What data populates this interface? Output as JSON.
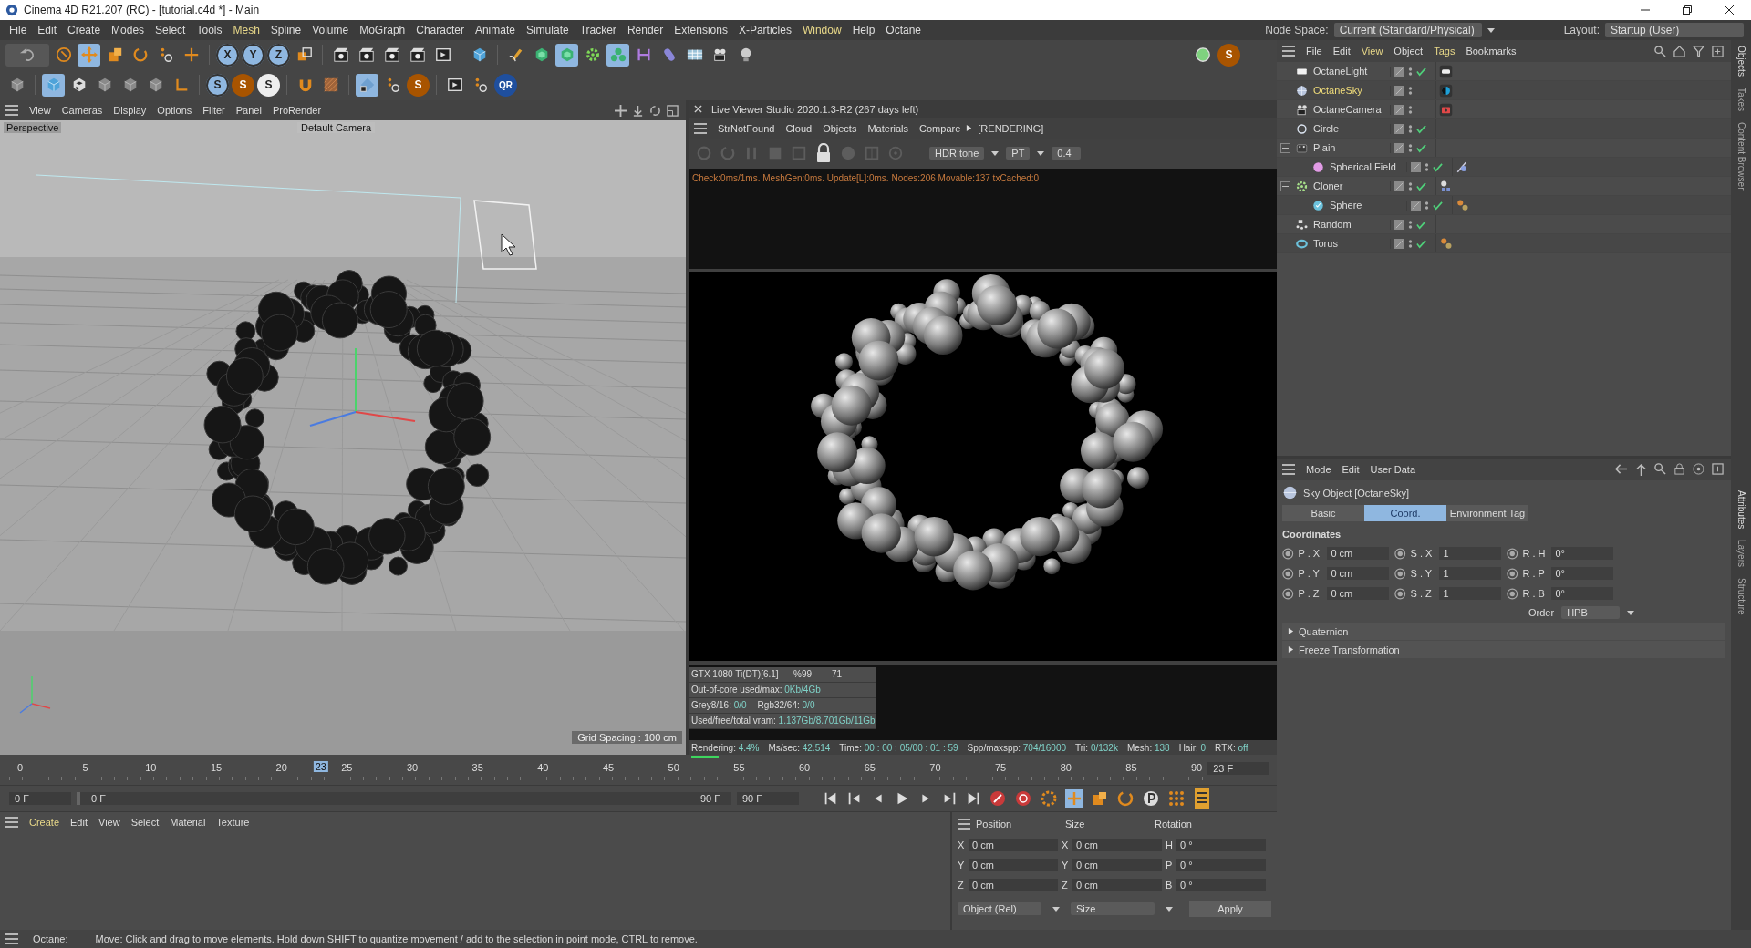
{
  "window": {
    "title": "Cinema 4D R21.207 (RC) - [tutorial.c4d *] - Main"
  },
  "menu": [
    {
      "label": "File",
      "highlight": false
    },
    {
      "label": "Edit",
      "highlight": false
    },
    {
      "label": "Create",
      "highlight": false
    },
    {
      "label": "Modes",
      "highlight": false
    },
    {
      "label": "Select",
      "highlight": false
    },
    {
      "label": "Tools",
      "highlight": false
    },
    {
      "label": "Mesh",
      "highlight": true
    },
    {
      "label": "Spline",
      "highlight": false
    },
    {
      "label": "Volume",
      "highlight": false
    },
    {
      "label": "MoGraph",
      "highlight": false
    },
    {
      "label": "Character",
      "highlight": false
    },
    {
      "label": "Animate",
      "highlight": false
    },
    {
      "label": "Simulate",
      "highlight": false
    },
    {
      "label": "Tracker",
      "highlight": false
    },
    {
      "label": "Render",
      "highlight": false
    },
    {
      "label": "Extensions",
      "highlight": false
    },
    {
      "label": "X-Particles",
      "highlight": false
    },
    {
      "label": "Window",
      "highlight": true
    },
    {
      "label": "Help",
      "highlight": false
    },
    {
      "label": "Octane",
      "highlight": false
    }
  ],
  "node_space": {
    "label": "Node Space:",
    "value": "Current (Standard/Physical)"
  },
  "layout": {
    "label": "Layout:",
    "value": "Startup (User)"
  },
  "toolbars": {
    "row_1": [
      {
        "kind": "undo",
        "selected": false
      },
      {
        "kind": "cursor",
        "selected": false
      },
      {
        "kind": "move",
        "selected": true
      },
      {
        "kind": "scale",
        "selected": false
      },
      {
        "kind": "rotate",
        "selected": false
      },
      {
        "kind": "dots",
        "selected": false
      },
      {
        "kind": "plus",
        "selected": false
      },
      {
        "kind": "letter",
        "label": "X",
        "selected": true
      },
      {
        "kind": "letter",
        "label": "Y",
        "selected": true
      },
      {
        "kind": "letter",
        "label": "Z",
        "selected": true
      },
      {
        "kind": "coord",
        "selected": false
      },
      {
        "kind": "clapper",
        "selected": false
      },
      {
        "kind": "clapper",
        "selected": false
      },
      {
        "kind": "clapper",
        "selected": false
      },
      {
        "kind": "clapper",
        "selected": false
      },
      {
        "kind": "picture",
        "selected": false
      },
      {
        "kind": "cube",
        "selected": false
      },
      {
        "kind": "pen",
        "selected": false
      },
      {
        "kind": "blob",
        "selected": false
      },
      {
        "kind": "blob",
        "selected": true
      },
      {
        "kind": "gear",
        "selected": false
      },
      {
        "kind": "cloner",
        "selected": true
      },
      {
        "kind": "bracket",
        "selected": false
      },
      {
        "kind": "capsule",
        "selected": false
      },
      {
        "kind": "grid",
        "selected": false
      },
      {
        "kind": "camera",
        "selected": false
      },
      {
        "kind": "bulb",
        "selected": false
      }
    ],
    "row_2": [
      {
        "kind": "gcube",
        "selected": false
      },
      {
        "kind": "cube",
        "selected": true
      },
      {
        "kind": "checker",
        "selected": false
      },
      {
        "kind": "gcube",
        "selected": false
      },
      {
        "kind": "gcube",
        "selected": false
      },
      {
        "kind": "gcube",
        "selected": false
      },
      {
        "kind": "axes",
        "selected": false
      },
      {
        "kind": "letter",
        "label": "S",
        "selected": true
      },
      {
        "kind": "letter-orange",
        "label": "S",
        "selected": false
      },
      {
        "kind": "letter-white",
        "label": "S",
        "selected": false
      },
      {
        "kind": "magnet",
        "selected": false
      },
      {
        "kind": "texture",
        "selected": false
      },
      {
        "kind": "lockgrid",
        "selected": true
      },
      {
        "kind": "dots",
        "selected": false
      },
      {
        "kind": "letter-orange",
        "label": "S",
        "selected": false
      },
      {
        "kind": "picture",
        "selected": false
      },
      {
        "kind": "dots",
        "selected": false
      },
      {
        "kind": "letter-blue",
        "label": "QR",
        "selected": false
      }
    ],
    "right": [
      {
        "kind": "orb",
        "selected": false
      },
      {
        "kind": "letter-orange",
        "label": "S",
        "selected": false
      }
    ]
  },
  "viewport": {
    "menu": [
      "View",
      "Cameras",
      "Display",
      "Options",
      "Filter",
      "Panel",
      "ProRender"
    ],
    "view_name": "Perspective",
    "camera": "Default Camera",
    "grid_spacing": "Grid Spacing : 100 cm"
  },
  "live_viewer": {
    "title": "Live Viewer Studio 2020.1.3-R2 (267 days left)",
    "menu": [
      "StrNotFound",
      "Cloud",
      "Objects",
      "Materials",
      "Compare"
    ],
    "status": "[RENDERING]",
    "tone_mode": "HDR tone",
    "kernel": "PT",
    "value": "0.4",
    "log": "Check:0ms/1ms. MeshGen:0ms. Update[L]:0ms. Nodes:206 Movable:137 txCached:0",
    "gpu": {
      "name": "GTX 1080 Ti(DT)[6.1]",
      "load": "%99",
      "temp": "71"
    },
    "stats": [
      [
        {
          "label": "Out-of-core used/max:",
          "value": "0Kb/4Gb"
        }
      ],
      [
        {
          "label": "Grey8/16:",
          "value": "0/0"
        },
        {
          "label": "Rgb32/64:",
          "value": "0/0"
        }
      ],
      [
        {
          "label": "Used/free/total vram:",
          "value": "1.137Gb/8.701Gb/11Gb"
        }
      ]
    ],
    "render_line": [
      {
        "label": "Rendering:",
        "value": "4.4%"
      },
      {
        "label": "Ms/sec:",
        "value": "42.514"
      },
      {
        "label": "Time:",
        "value": "00 : 00 : 05/00 : 01 : 59"
      },
      {
        "label": "Spp/maxspp:",
        "value": "704/16000"
      },
      {
        "label": "Tri:",
        "value": "0/132k"
      },
      {
        "label": "Mesh:",
        "value": "138"
      },
      {
        "label": "Hair:",
        "value": "0"
      },
      {
        "label": "RTX:",
        "value": "off"
      }
    ],
    "progress": {
      "level": 0.05
    }
  },
  "objects": {
    "menu": [
      {
        "label": "File",
        "highlight": false
      },
      {
        "label": "Edit",
        "highlight": false
      },
      {
        "label": "View",
        "highlight": true
      },
      {
        "label": "Object",
        "highlight": false
      },
      {
        "label": "Tags",
        "highlight": true
      },
      {
        "label": "Bookmarks",
        "highlight": false
      }
    ],
    "items": [
      {
        "name": "OctaneLight",
        "kind": "light",
        "selected": false,
        "enabled": true,
        "tags": [
          {
            "kind": "light-tag"
          }
        ]
      },
      {
        "name": "OctaneSky",
        "kind": "sky",
        "selected": true,
        "enabled": false,
        "tags": [
          {
            "kind": "environment-tag"
          }
        ]
      },
      {
        "name": "OctaneCamera",
        "kind": "camera-obj",
        "selected": false,
        "enabled": false,
        "tags": [
          {
            "kind": "camera-tag"
          }
        ]
      },
      {
        "name": "Circle",
        "kind": "circle",
        "selected": false,
        "enabled": true
      },
      {
        "name": "Plain",
        "kind": "plain",
        "selected": false,
        "enabled": true,
        "expanded": true,
        "children": [
          {
            "name": "Spherical Field",
            "kind": "field",
            "selected": false,
            "enabled": true,
            "tags": [
              {
                "kind": "field-tag"
              }
            ]
          }
        ]
      },
      {
        "name": "Cloner",
        "kind": "cloner-obj",
        "selected": false,
        "enabled": true,
        "tags": [
          {
            "kind": "cloner-tag"
          }
        ],
        "expanded": true,
        "children": [
          {
            "name": "Sphere",
            "kind": "sphere",
            "selected": false,
            "enabled": true,
            "tags": [
              {
                "kind": "material-tag"
              }
            ]
          }
        ]
      },
      {
        "name": "Random",
        "kind": "random",
        "selected": false,
        "enabled": true
      },
      {
        "name": "Torus",
        "kind": "torus",
        "selected": false,
        "enabled": true,
        "tags": [
          {
            "kind": "material-tag"
          }
        ]
      }
    ]
  },
  "attributes": {
    "menu": [
      "Mode",
      "Edit",
      "User Data"
    ],
    "object": "Sky Object [OctaneSky]",
    "tabs": [
      {
        "label": "Basic",
        "selected": false
      },
      {
        "label": "Coord.",
        "selected": true
      },
      {
        "label": "Environment Tag",
        "selected": false
      }
    ],
    "section": "Coordinates",
    "coordinates": [
      {
        "cells": [
          {
            "label": "P . X",
            "value": "0 cm"
          },
          {
            "label": "S . X",
            "value": "1"
          },
          {
            "label": "R . H",
            "value": "0°"
          }
        ]
      },
      {
        "cells": [
          {
            "label": "P . Y",
            "value": "0 cm"
          },
          {
            "label": "S . Y",
            "value": "1"
          },
          {
            "label": "R . P",
            "value": "0°"
          }
        ]
      },
      {
        "cells": [
          {
            "label": "P . Z",
            "value": "0 cm"
          },
          {
            "label": "S . Z",
            "value": "1"
          },
          {
            "label": "R . B",
            "value": "0°"
          }
        ]
      }
    ],
    "order": {
      "label": "Order",
      "value": "HPB"
    },
    "groups": [
      {
        "label": "Quaternion",
        "expanded": false
      },
      {
        "label": "Freeze Transformation",
        "expanded": false
      }
    ]
  },
  "side_tabs": {
    "top": [
      "Objects",
      "Takes",
      "Content Browser"
    ],
    "bottom": [
      "Attributes",
      "Layers",
      "Structure"
    ]
  },
  "timeline": {
    "ticks": [
      "0",
      "5",
      "10",
      "15",
      "20",
      "25",
      "30",
      "35",
      "40",
      "45",
      "50",
      "55",
      "60",
      "65",
      "70",
      "75",
      "80",
      "85",
      "90"
    ],
    "playhead": {
      "label": "23",
      "level": 0.2556
    },
    "current": "23 F",
    "start": "0 F",
    "range": {
      "start": "0 F",
      "end": "90 F",
      "level": 1
    },
    "end": "90 F"
  },
  "materials": {
    "menu": [
      {
        "label": "Create",
        "highlight": true
      },
      {
        "label": "Edit",
        "highlight": false
      },
      {
        "label": "View",
        "highlight": false
      },
      {
        "label": "Select",
        "highlight": false
      },
      {
        "label": "Material",
        "highlight": false
      },
      {
        "label": "Texture",
        "highlight": false
      }
    ]
  },
  "coordinates": {
    "headers": [
      "Position",
      "Size",
      "Rotation"
    ],
    "rows": [
      {
        "cells": [
          {
            "axis": "X",
            "value": "0 cm"
          },
          {
            "axis": "X",
            "value": "0 cm"
          },
          {
            "axis": "H",
            "value": "0 °"
          }
        ]
      },
      {
        "cells": [
          {
            "axis": "Y",
            "value": "0 cm"
          },
          {
            "axis": "Y",
            "value": "0 cm"
          },
          {
            "axis": "P",
            "value": "0 °"
          }
        ]
      },
      {
        "cells": [
          {
            "axis": "Z",
            "value": "0 cm"
          },
          {
            "axis": "Z",
            "value": "0 cm"
          },
          {
            "axis": "B",
            "value": "0 °"
          }
        ]
      }
    ],
    "mode": "Object (Rel)",
    "size_mode": "Size",
    "apply": "Apply"
  },
  "status": {
    "label": "Octane:",
    "message": "Move: Click and drag to move elements. Hold down SHIFT to quantize movement / add to the selection in point mode, CTRL to remove."
  }
}
